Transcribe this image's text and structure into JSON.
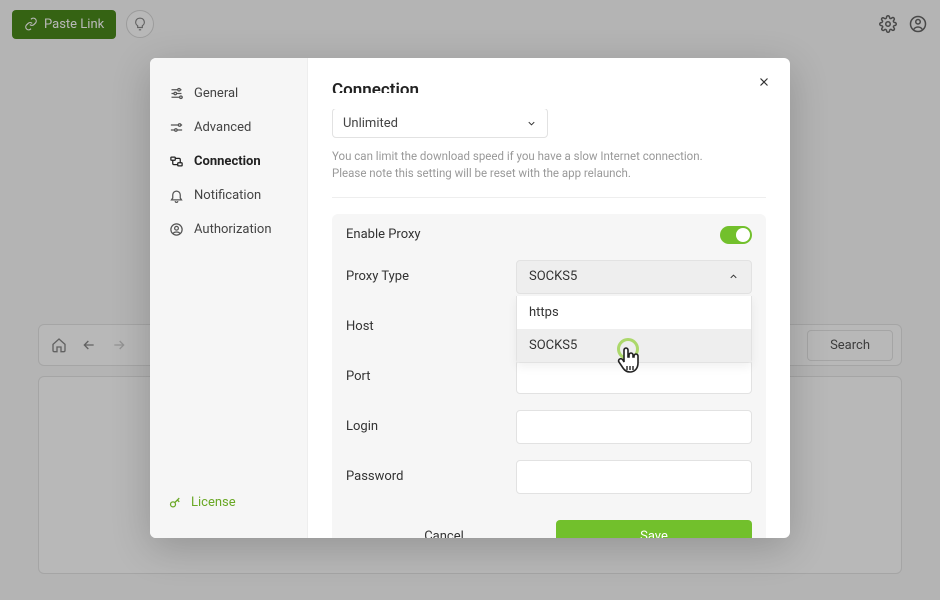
{
  "topbar": {
    "paste_label": "Paste Link",
    "search_label": "Search"
  },
  "modal": {
    "title": "Connection",
    "sidebar": {
      "items": [
        {
          "label": "General"
        },
        {
          "label": "Advanced"
        },
        {
          "label": "Connection"
        },
        {
          "label": "Notification"
        },
        {
          "label": "Authorization"
        }
      ],
      "license_label": "License"
    },
    "speed_select_value": "Unlimited",
    "hint_line1": "You can limit the download speed if you have a slow Internet connection.",
    "hint_line2": "Please note this setting will be reset with the app relaunch.",
    "enable_proxy_label": "Enable Proxy",
    "enable_proxy_value": true,
    "proxy_type_label": "Proxy Type",
    "proxy_type_value": "SOCKS5",
    "proxy_type_options": [
      "https",
      "SOCKS5"
    ],
    "host_label": "Host",
    "host_value": "",
    "port_label": "Port",
    "port_value": "",
    "login_label": "Login",
    "login_value": "",
    "password_label": "Password",
    "password_value": "",
    "cancel_label": "Cancel",
    "save_label": "Save"
  }
}
